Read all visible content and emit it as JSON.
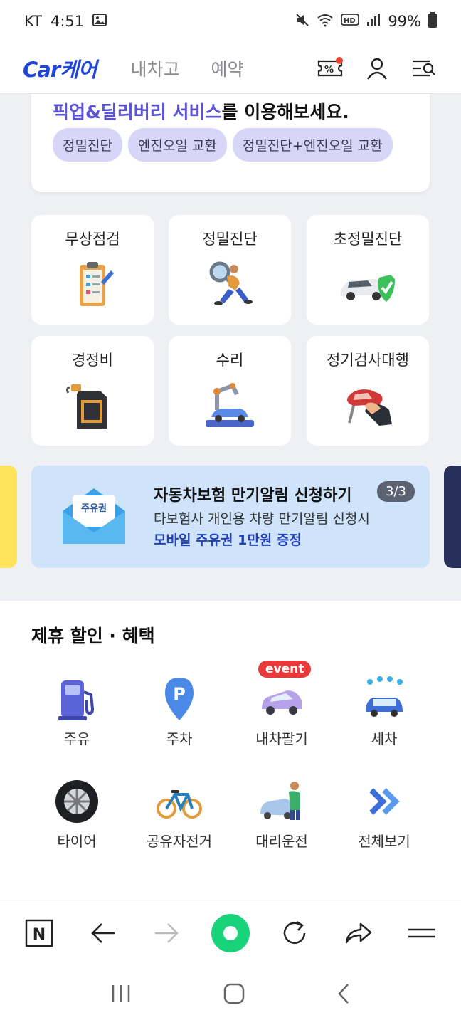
{
  "status_bar": {
    "carrier": "KT",
    "time": "4:51",
    "battery": "99%"
  },
  "header": {
    "logo": "Car케어",
    "nav": [
      "내차고",
      "예약"
    ]
  },
  "pickup": {
    "title_highlight": "픽업&딜리버리 서비스",
    "title_rest": "를 이용해보세요.",
    "chips": [
      "정밀진단",
      "엔진오일 교환",
      "정밀진단+엔진오일 교환"
    ]
  },
  "services": [
    {
      "label": "무상점검",
      "icon": "clipboard-checklist-icon"
    },
    {
      "label": "정밀진단",
      "icon": "magnifier-person-icon"
    },
    {
      "label": "초정밀진단",
      "icon": "car-shield-icon"
    },
    {
      "label": "경정비",
      "icon": "oil-canister-icon"
    },
    {
      "label": "수리",
      "icon": "robot-arm-car-icon"
    },
    {
      "label": "정기검사대행",
      "icon": "hand-car-icon"
    }
  ],
  "banner": {
    "envelope_label": "주유권",
    "title": "자동차보험 만기알림 신청하기",
    "subtitle": "타보험사 개인용 차량 만기알림 신청시",
    "highlight": "모바일 주유권 1만원 증정",
    "page": "3/3"
  },
  "benefits": {
    "title": "제휴 할인 · 혜택",
    "event_badge": "event",
    "items": [
      {
        "label": "주유",
        "icon": "fuel-pump-icon"
      },
      {
        "label": "주차",
        "icon": "parking-pin-icon"
      },
      {
        "label": "내차팔기",
        "icon": "purple-car-icon"
      },
      {
        "label": "세차",
        "icon": "car-wash-icon"
      },
      {
        "label": "타이어",
        "icon": "tire-icon"
      },
      {
        "label": "공유자전거",
        "icon": "bicycle-icon"
      },
      {
        "label": "대리운전",
        "icon": "driver-car-icon"
      },
      {
        "label": "전체보기",
        "icon": "double-chevron-icon"
      }
    ]
  },
  "colors": {
    "brand": "#1f46d8",
    "accent": "#5b55d6",
    "chip": "#d7d6f8",
    "banner": "#cfe4fb",
    "green": "#19d37a"
  }
}
